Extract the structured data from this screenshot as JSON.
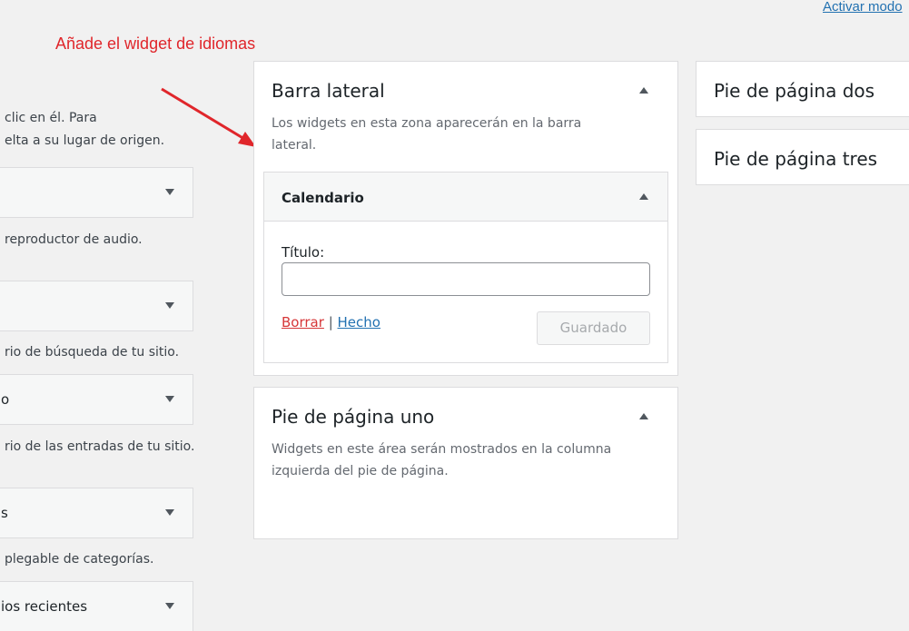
{
  "top_link": "Activar modo",
  "annotation": "Añade el widget de idiomas",
  "available": {
    "intro_line1": "clic en él. Para",
    "intro_line2": "elta a su lugar de origen.",
    "widgets": [
      {
        "name": "",
        "desc": "reproductor de audio."
      },
      {
        "name": "",
        "desc": "rio de búsqueda de tu sitio."
      },
      {
        "name": "o",
        "desc": "rio de las entradas de tu sitio."
      },
      {
        "name": "s",
        "desc": "plegable de categorías."
      },
      {
        "name": "ios recientes",
        "desc": ""
      }
    ]
  },
  "sidebar": {
    "title": "Barra lateral",
    "desc": "Los widgets en esta zona aparecerán en la barra lateral.",
    "widget": {
      "title": "Calendario",
      "field_label": "Título:",
      "field_value": "",
      "delete_label": "Borrar",
      "separator": "|",
      "done_label": "Hecho",
      "saved_label": "Guardado"
    }
  },
  "footer1": {
    "title": "Pie de página uno",
    "desc": "Widgets en este área serán mostrados en la columna izquierda del pie de página."
  },
  "footer2": {
    "title": "Pie de página dos"
  },
  "footer3": {
    "title": "Pie de página tres"
  },
  "colors": {
    "accent_link": "#2271b1",
    "delete_link": "#d63638",
    "annotation": "#e0262b"
  }
}
